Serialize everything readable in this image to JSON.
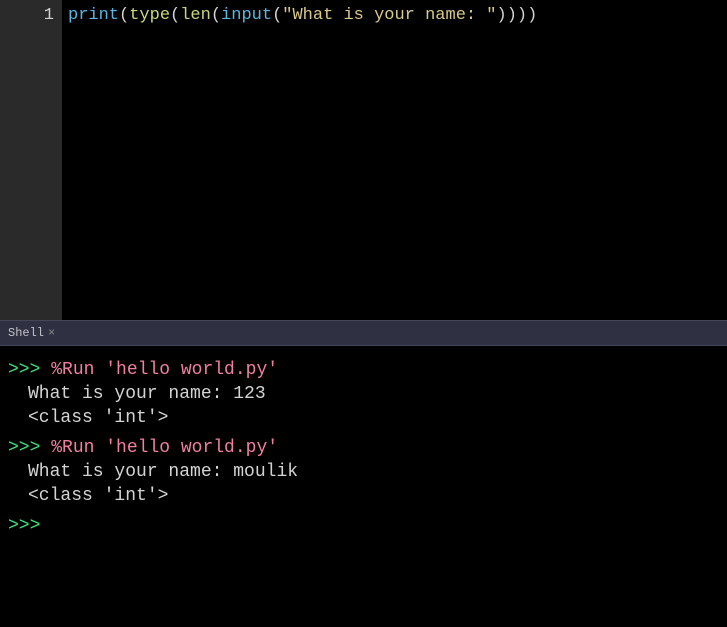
{
  "editor": {
    "line_number": "1",
    "code": {
      "print": "print",
      "p1": "(",
      "type": "type",
      "p2": "(",
      "len": "len",
      "p3": "(",
      "input": "input",
      "p4": "(",
      "string": "\"What is your name: \"",
      "p5": "))))"
    }
  },
  "tab": {
    "label": "Shell",
    "close": "×"
  },
  "shell": {
    "prompt": ">>> ",
    "run1": "%Run 'hello world.py'",
    "out1_line1": "What is your name: 123",
    "out1_line2": "<class 'int'>",
    "run2": "%Run 'hello world.py'",
    "out2_line1": "What is your name: moulik",
    "out2_line2": "<class 'int'>",
    "prompt_final": ">>> "
  }
}
